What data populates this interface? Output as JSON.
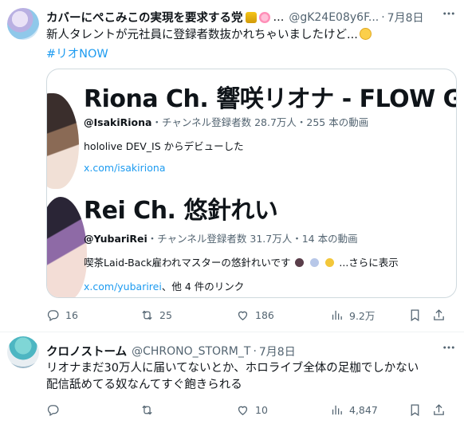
{
  "post1": {
    "author_name": "カバーにぺこみこの実現を要求する党",
    "ellipsis": "...",
    "handle": "@gK24E08y6F...",
    "separator": "·",
    "time": "7月8日",
    "text": "新人タレントが元社員に登録者数抜かれちゃいましたけど...",
    "hashtag": "#リオNOW",
    "card": {
      "channel1": {
        "title": "Riona Ch. 響咲リオナ - FLOW GI",
        "handle": "@IsakiRiona",
        "stats": "・チャンネル登録者数 28.7万人・255 本の動画",
        "description": "hololive DEV_IS からデビューした",
        "link": "x.com/isakiriona"
      },
      "channel2": {
        "title": "Rei Ch. 悠針れい",
        "handle": "@YubariRei",
        "stats": "・チャンネル登録者数 31.7万人・14 本の動画",
        "description": "喫茶Laid-Back雇われマスターの悠針れいです",
        "show_more": "...さらに表示",
        "link": "x.com/yubarirei",
        "link_suffix": "、他 4 件のリンク"
      }
    },
    "actions": {
      "reply_count": "16",
      "repost_count": "25",
      "like_count": "186",
      "views_count": "9.2万"
    }
  },
  "post2": {
    "author_name": "クロノストーム",
    "handle": "@CHRONO_STORM_T",
    "separator": "·",
    "time": "7月8日",
    "text_line1": "リオナまだ30万人に届いてないとか、ホロライブ全体の足枷でしかない",
    "text_line2": "配信舐めてる奴なんてすぐ飽きられる",
    "actions": {
      "reply_count": "",
      "repost_count": "",
      "like_count": "10",
      "views_count": "4,847"
    }
  },
  "colors": {
    "accent": "#1d9bf0",
    "secondary_text": "#536471",
    "primary_text": "#0f1419",
    "border": "#cfd9de"
  },
  "icons": [
    "more-icon",
    "reply-icon",
    "repost-icon",
    "like-icon",
    "views-icon",
    "bookmark-icon",
    "share-icon"
  ]
}
